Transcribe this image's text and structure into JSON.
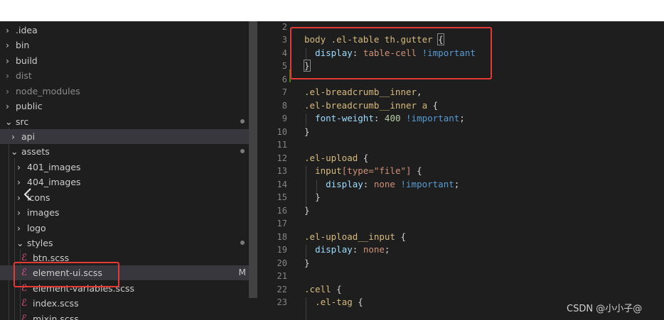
{
  "explorer": {
    "items": [
      {
        "label": ".idea"
      },
      {
        "label": "bin"
      },
      {
        "label": "build"
      },
      {
        "label": "dist"
      },
      {
        "label": "node_modules"
      },
      {
        "label": "public"
      },
      {
        "label": "src"
      },
      {
        "label": "api"
      },
      {
        "label": "assets"
      },
      {
        "label": "401_images"
      },
      {
        "label": "404_images"
      },
      {
        "label": "icons"
      },
      {
        "label": "images"
      },
      {
        "label": "logo"
      },
      {
        "label": "styles"
      },
      {
        "label": "btn.scss"
      },
      {
        "label": "element-ui.scss",
        "badge": "M"
      },
      {
        "label": "element-variables.scss"
      },
      {
        "label": "index.scss"
      },
      {
        "label": "mixin.scss"
      }
    ]
  },
  "editor": {
    "line_numbers": [
      "2",
      "3",
      "4",
      "5",
      "6",
      "7",
      "8",
      "9",
      "10",
      "11",
      "12",
      "13",
      "14",
      "15",
      "16",
      "17",
      "18",
      "19",
      "20",
      "21",
      "22",
      "23"
    ],
    "code": {
      "l3_selector": "body .el-table th.gutter",
      "l3_brace": "{",
      "l4_prop": "display",
      "l4_val": "table-cell",
      "l4_imp": "!important",
      "l5_brace": "}",
      "l7_selector": ".el-breadcrumb__inner",
      "l8_selector": ".el-breadcrumb__inner a",
      "l9_prop": "font-weight",
      "l9_num": "400",
      "l9_imp": "!important",
      "l10": "}",
      "l12_selector": ".el-upload",
      "l13_selector": "input",
      "l13_attr": "[type=\"file\"]",
      "l14_prop": "display",
      "l14_val": "none",
      "l14_imp": "!important",
      "l15": "}",
      "l16": "}",
      "l18_selector": ".el-upload__input",
      "l19_prop": "display",
      "l19_val": "none",
      "l20": "}",
      "l22_selector": ".cell",
      "l23_selector": ".el-tag"
    }
  },
  "watermark": "CSDN @小小子@",
  "colors": {
    "annotation": "#e53935",
    "modified_badge": "#c8c8c8"
  }
}
